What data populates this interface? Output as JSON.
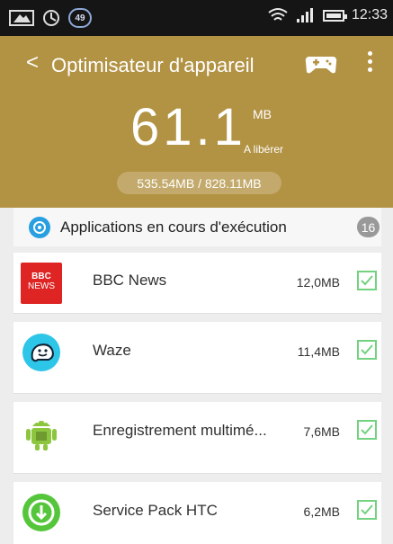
{
  "status": {
    "notification_count": "49",
    "time": "12:33"
  },
  "header": {
    "back_glyph": "<",
    "title": "Optimisateur d'appareil",
    "big_value": "61.1",
    "unit": "MB",
    "sub_label": "A libérer",
    "memory_text": "535.54MB / 828.11MB"
  },
  "section": {
    "title": "Applications en cours d'exécution",
    "count": "16"
  },
  "apps": [
    {
      "name": "BBC News",
      "size": "12,0MB",
      "checked": true,
      "icon": "bbc-news-icon"
    },
    {
      "name": "Waze",
      "size": "11,4MB",
      "checked": true,
      "icon": "waze-icon"
    },
    {
      "name": "Enregistrement multimé...",
      "size": "7,6MB",
      "checked": true,
      "icon": "android-icon"
    },
    {
      "name": "Service Pack HTC",
      "size": "6,2MB",
      "checked": true,
      "icon": "service-pack-icon"
    }
  ],
  "bbc_logo": {
    "line1": "BBC",
    "line2": "NEWS"
  },
  "colors": {
    "header": "#b29243",
    "accent": "#279fe0",
    "check": "#72d27f"
  }
}
